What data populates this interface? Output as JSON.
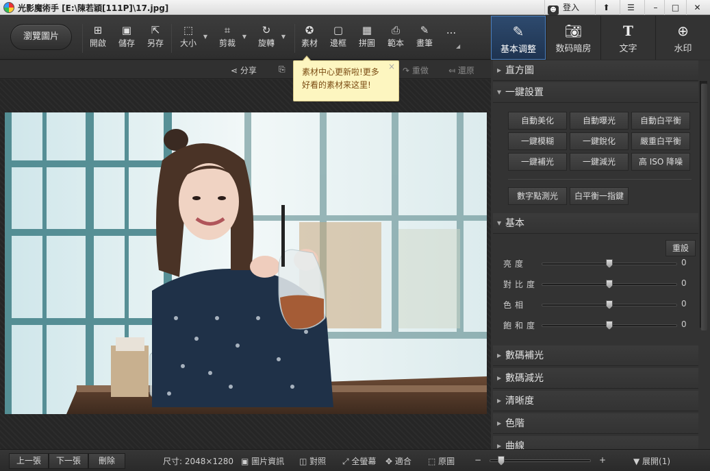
{
  "window": {
    "title": "光影魔術手  [E:\\陳若穎[111P]\\17.jpg]",
    "login_label": "登入"
  },
  "toolbar": {
    "browse_label": "瀏覽圖片",
    "items": [
      {
        "label": "開啟",
        "icon": "open-icon"
      },
      {
        "label": "儲存",
        "icon": "save-icon"
      },
      {
        "label": "另存",
        "icon": "save-as-icon"
      },
      {
        "label": "大小",
        "icon": "resize-icon"
      },
      {
        "label": "剪裁",
        "icon": "crop-icon"
      },
      {
        "label": "旋轉",
        "icon": "rotate-icon"
      },
      {
        "label": "素材",
        "icon": "material-icon"
      },
      {
        "label": "邊框",
        "icon": "border-icon"
      },
      {
        "label": "拼圖",
        "icon": "collage-icon"
      },
      {
        "label": "範本",
        "icon": "template-icon"
      },
      {
        "label": "畫筆",
        "icon": "brush-icon"
      }
    ],
    "more_label": "..."
  },
  "tabs": [
    {
      "label": "基本调整",
      "icon": "edit-icon",
      "active": true
    },
    {
      "label": "数码暗房",
      "icon": "camera-icon",
      "active": false
    },
    {
      "label": "文字",
      "icon": "text-icon",
      "active": false
    },
    {
      "label": "水印",
      "icon": "watermark-icon",
      "active": false
    }
  ],
  "subbar": {
    "share": "分享",
    "redo": "重做",
    "restore": "還原"
  },
  "tooltip": {
    "text1": "素材中心更新啦!更多",
    "text2": "好看的素材来这里!",
    "close": "×"
  },
  "panel": {
    "histogram": "直方圖",
    "oneclick": "一鍵設置",
    "oneclick_buttons": [
      "自動美化",
      "自動曝光",
      "自動白平衡",
      "一鍵模糊",
      "一鍵銳化",
      "嚴重白平衡",
      "一鍵補光",
      "一鍵減光",
      "高 ISO 降噪"
    ],
    "extra_buttons": [
      "數字點測光",
      "白平衡一指鍵"
    ],
    "basic": "基本",
    "reset": "重設",
    "sliders": [
      {
        "name": "亮度",
        "value": "0",
        "fraction": 0.5
      },
      {
        "name": "對比度",
        "value": "0",
        "fraction": 0.5
      },
      {
        "name": "色相",
        "value": "0",
        "fraction": 0.5
      },
      {
        "name": "飽和度",
        "value": "0",
        "fraction": 0.5
      }
    ],
    "sections": [
      "數碼補光",
      "數碼減光",
      "清晰度",
      "色階",
      "曲線"
    ]
  },
  "status": {
    "prev": "上一張",
    "next": "下一張",
    "delete": "刪除",
    "size": "尺寸: 2048×1280",
    "info": "圖片資訊",
    "compare": "對照",
    "fullscreen": "全螢幕",
    "fit": "適合",
    "original": "原圖",
    "minus": "−",
    "plus": "+",
    "expand": "展開(1)"
  }
}
